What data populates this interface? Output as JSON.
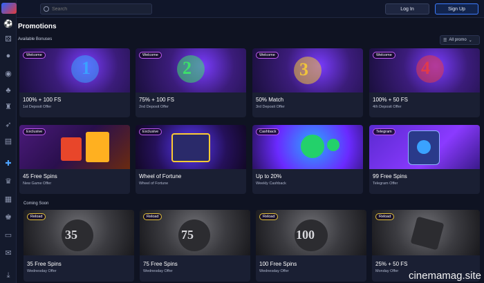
{
  "header": {
    "search_placeholder": "Search",
    "login_label": "Log In",
    "signup_label": "Sign Up"
  },
  "page": {
    "title": "Promotions",
    "available_label": "Available Bonuses",
    "coming_soon_label": "Coming Soon",
    "filter_label": "All promo"
  },
  "available": [
    {
      "tag": "Welcome",
      "title": "100% + 100 FS",
      "sub": "1st Deposit Offer",
      "num": "1",
      "num_color": "#3aa2ff"
    },
    {
      "tag": "Welcome",
      "title": "75% + 100 FS",
      "sub": "2nd Deposit Offer",
      "num": "2",
      "num_color": "#3de06a"
    },
    {
      "tag": "Welcome",
      "title": "50% Match",
      "sub": "3rd Deposit Offer",
      "num": "3",
      "num_color": "#f0c43a"
    },
    {
      "tag": "Welcome",
      "title": "100% + 50 FS",
      "sub": "4th Deposit Offer",
      "num": "4",
      "num_color": "#e23a4a"
    },
    {
      "tag": "Exclusive",
      "title": "45 Free Spins",
      "sub": "New Game Offer"
    },
    {
      "tag": "Exclusive",
      "title": "Wheel of Fortune",
      "sub": "Wheel of Fortune"
    },
    {
      "tag": "Cashback",
      "title": "Up to 20%",
      "sub": "Weekly Cashback"
    },
    {
      "tag": "Telegram",
      "title": "99 Free Spins",
      "sub": "Telegram Offer"
    }
  ],
  "coming_soon": [
    {
      "tag": "Reload",
      "title": "35 Free Spins",
      "sub": "Wednesday Offer",
      "num": "35"
    },
    {
      "tag": "Reload",
      "title": "75 Free Spins",
      "sub": "Wednesday Offer",
      "num": "75"
    },
    {
      "tag": "Reload",
      "title": "100 Free Spins",
      "sub": "Wednesday Offer",
      "num": "100"
    },
    {
      "tag": "Reload",
      "title": "25% + 50 FS",
      "sub": "Monday Offer"
    }
  ],
  "watermark": "cinemamag.site"
}
